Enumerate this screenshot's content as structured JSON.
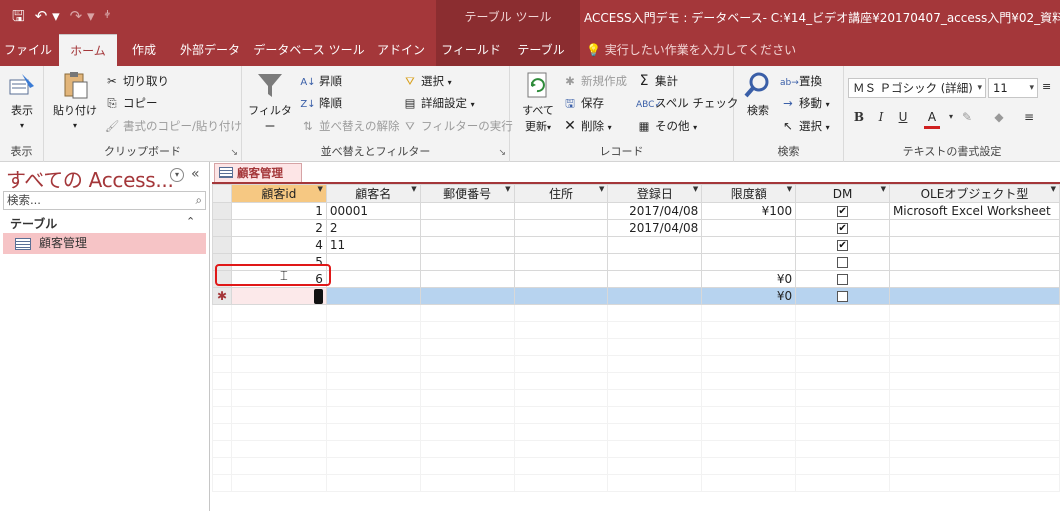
{
  "title_bar": {
    "context_label": "テーブル ツール",
    "window_title": "ACCESS入門デモ : データベース- C:¥14_ビデオ講座¥20170407_access入門¥02_資料¥ACCE"
  },
  "tabs": [
    "ファイル",
    "ホーム",
    "作成",
    "外部データ",
    "データベース ツール",
    "アドイン",
    "フィールド",
    "テーブル"
  ],
  "tell_me": "実行したい作業を入力してください",
  "ribbon": {
    "view": {
      "label": "表示",
      "group": "表示"
    },
    "clipboard": {
      "paste": "貼り付け",
      "cut": "切り取り",
      "copy": "コピー",
      "format_painter": "書式のコピー/貼り付け",
      "group": "クリップボード"
    },
    "sort_filter": {
      "filter": "フィルター",
      "ascending": "昇順",
      "descending": "降順",
      "remove_sort": "並べ替えの解除",
      "selection": "選択",
      "advanced": "詳細設定",
      "toggle_filter": "フィルターの実行",
      "group": "並べ替えとフィルター"
    },
    "records": {
      "refresh_all_1": "すべて",
      "refresh_all_2": "更新",
      "new": "新規作成",
      "save": "保存",
      "delete": "削除",
      "totals": "集計",
      "spelling": "スペル チェック",
      "more": "その他",
      "group": "レコード"
    },
    "find": {
      "find": "検索",
      "replace": "置換",
      "goto": "移動",
      "select": "選択",
      "group": "検索"
    },
    "text_format": {
      "font": "ＭＳ Ｐゴシック (詳細)",
      "size": "11",
      "group": "テキストの書式設定"
    }
  },
  "nav": {
    "title": "すべての Access...",
    "search_placeholder": "検索...",
    "category": "テーブル",
    "item": "顧客管理"
  },
  "document": {
    "tab_label": "顧客管理",
    "columns": [
      "顧客id",
      "顧客名",
      "郵便番号",
      "住所",
      "登録日",
      "限度額",
      "DM",
      "OLEオブジェクト型"
    ],
    "rows": [
      {
        "id": "1",
        "name": "00001",
        "zip": "",
        "address": "",
        "date": "2017/04/08",
        "limit": "¥100",
        "dm": true,
        "ole": "Microsoft Excel Worksheet"
      },
      {
        "id": "2",
        "name": "2",
        "zip": "",
        "address": "",
        "date": "2017/04/08",
        "limit": "",
        "dm": true,
        "ole": ""
      },
      {
        "id": "4",
        "name": "11",
        "zip": "",
        "address": "",
        "date": "",
        "limit": "",
        "dm": true,
        "ole": ""
      },
      {
        "id": "5",
        "name": "",
        "zip": "",
        "address": "",
        "date": "",
        "limit": "",
        "dm": false,
        "ole": ""
      },
      {
        "id": "6",
        "name": "",
        "zip": "",
        "address": "",
        "date": "",
        "limit": "¥0",
        "dm": false,
        "ole": ""
      }
    ],
    "new_row": {
      "marker": "✱",
      "limit": "¥0",
      "dm": false
    }
  },
  "colors": {
    "accent": "#a4373a",
    "nav_selected": "#f6c4c6",
    "new_row": "#b7d3ef",
    "highlight": "#e01818"
  }
}
